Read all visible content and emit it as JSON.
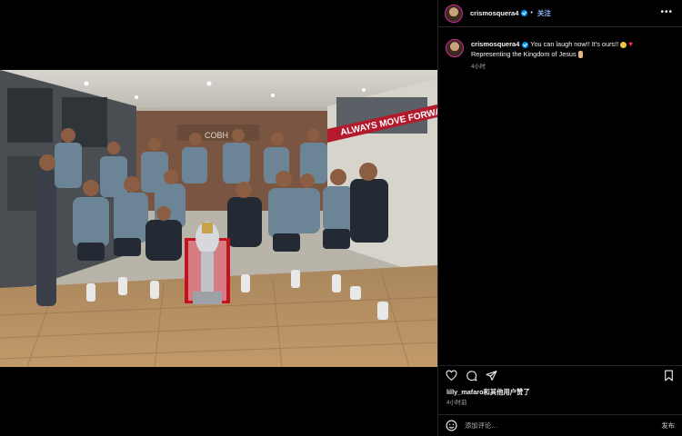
{
  "post": {
    "username": "crismosquera4",
    "follow_label": "关注",
    "more_label": "•••",
    "caption_user": "crismosquera4",
    "caption_line1": "You can laugh now!! It's ours!!",
    "caption_line2": "Representing the Kingdom of Jesus",
    "caption_time": "4小时",
    "likes_text": "lilly_mafaro和其他用户赞了",
    "likes_time": "4小时前",
    "comment_placeholder": "添加评论…",
    "post_label": "发布"
  },
  "photo": {
    "wall_text": "ALWAYS MOVE FORWARD",
    "sign_text": "COBH"
  },
  "colors": {
    "link": "#0095f6",
    "banner": "#b31b2c"
  }
}
